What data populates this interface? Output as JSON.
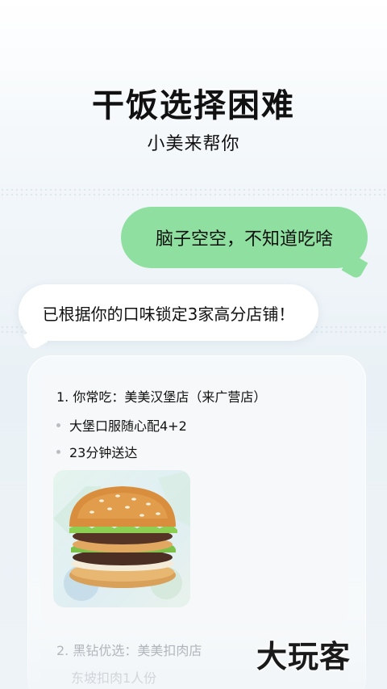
{
  "header": {
    "headline": "干饭选择困难",
    "subline": "小美来帮你"
  },
  "chat": {
    "user_message": "脑子空空，不知道吃啥",
    "bot_message": "已根据你的口味锁定3家高分店铺！"
  },
  "results": [
    {
      "title": "1. 你常吃：美美汉堡店（来广营店）",
      "bullets": [
        "大堡口服随心配4+2",
        "23分钟送达"
      ],
      "image": "burger-photo"
    },
    {
      "title": "2. 黑钻优选：美美扣肉店",
      "subtitle": "东坡扣肉1人份"
    }
  ],
  "watermark": "大玩客",
  "colors": {
    "user_bubble": "#8fe0a0",
    "bot_bubble": "#ffffff"
  }
}
